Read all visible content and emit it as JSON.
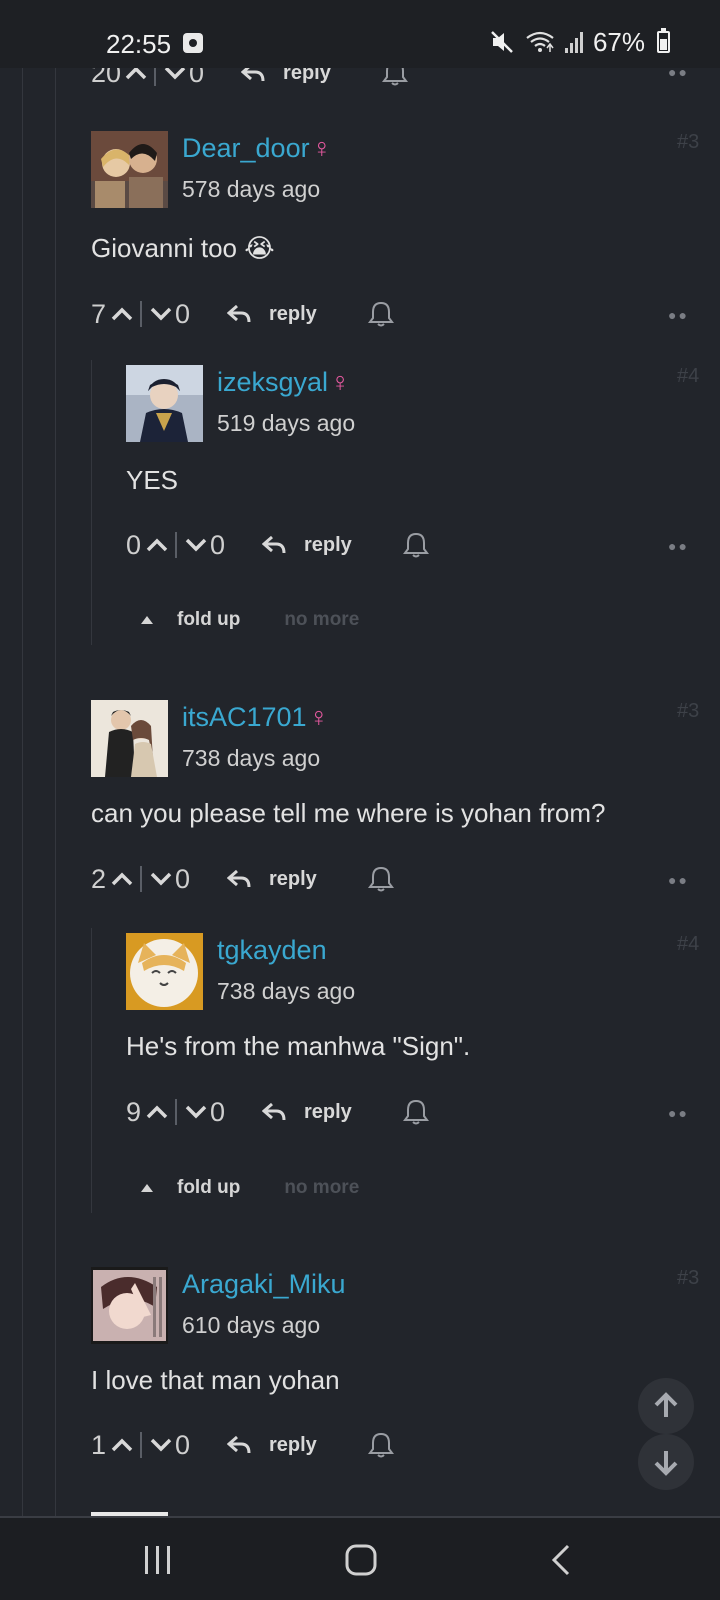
{
  "status_bar": {
    "time": "22:55",
    "battery": "67%"
  },
  "top_partial": {
    "upvotes": "20",
    "downvotes": "0",
    "reply_label": "reply"
  },
  "comments": [
    {
      "username": "Dear_door",
      "gender_symbol": "♀",
      "time": "578 days ago",
      "number": "#3",
      "text": "Giovanni too 😭",
      "upvotes": "7",
      "downvotes": "0",
      "reply_label": "reply"
    },
    {
      "username": "izeksgyal",
      "gender_symbol": "♀",
      "time": "519 days ago",
      "number": "#4",
      "text": "YES",
      "upvotes": "0",
      "downvotes": "0",
      "reply_label": "reply"
    },
    {
      "username": "itsAC1701",
      "gender_symbol": "♀",
      "time": "738 days ago",
      "number": "#3",
      "text": "can you please tell me where is yohan from?",
      "upvotes": "2",
      "downvotes": "0",
      "reply_label": "reply"
    },
    {
      "username": "tgkayden",
      "gender_symbol": "",
      "time": "738 days ago",
      "number": "#4",
      "text": "He's from the manhwa \"Sign\".",
      "upvotes": "9",
      "downvotes": "0",
      "reply_label": "reply"
    },
    {
      "username": "Aragaki_Miku",
      "gender_symbol": "",
      "time": "610 days ago",
      "number": "#3",
      "text": "I love that man yohan",
      "upvotes": "1",
      "downvotes": "0",
      "reply_label": "reply"
    }
  ],
  "fold": {
    "fold_label": "fold up",
    "no_more_label": "no more"
  },
  "colors": {
    "background": "#22252b",
    "username": "#3aa8d0",
    "female_symbol": "#e5599f"
  },
  "icons": [
    "mute-icon",
    "wifi-icon",
    "signal-icon",
    "battery-icon",
    "upvote-icon",
    "downvote-icon",
    "reply-icon",
    "bell-icon",
    "more-icon",
    "scroll-up-icon",
    "scroll-down-icon",
    "recents-icon",
    "home-icon",
    "back-icon"
  ]
}
